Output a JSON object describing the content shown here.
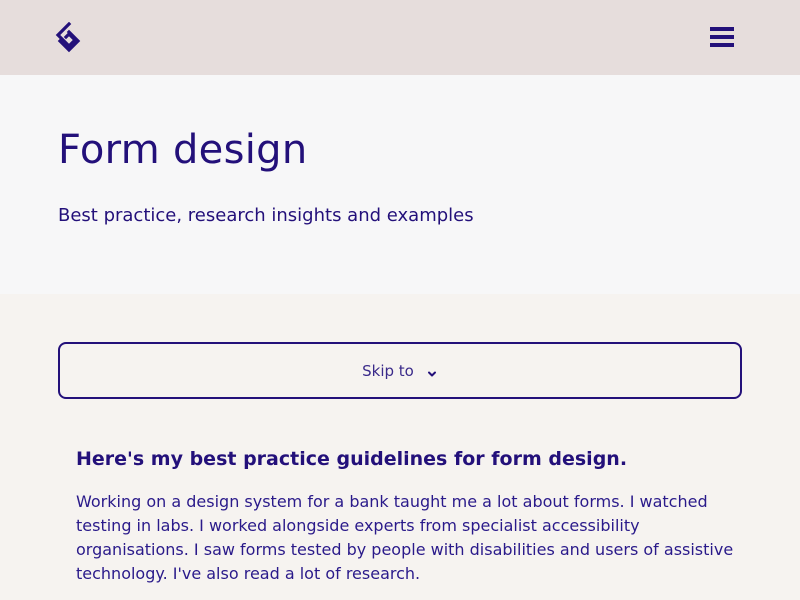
{
  "header": {
    "logo_icon": "diamond-logo-icon",
    "menu_icon": "hamburger-menu-icon",
    "brand_color": "#23107a"
  },
  "hero": {
    "title": "Form design",
    "subtitle": "Best practice, research insights and examples"
  },
  "skip": {
    "label": "Skip to",
    "icon": "chevron-down-icon"
  },
  "intro": {
    "heading": "Here's my best practice guidelines for form design.",
    "paragraph": "Working on a design system for a bank taught me a lot about forms. I watched testing in labs. I worked alongside experts from specialist accessibility organisations. I saw forms tested by people with disabilities and users of assistive technology. I've also read a lot of research."
  }
}
